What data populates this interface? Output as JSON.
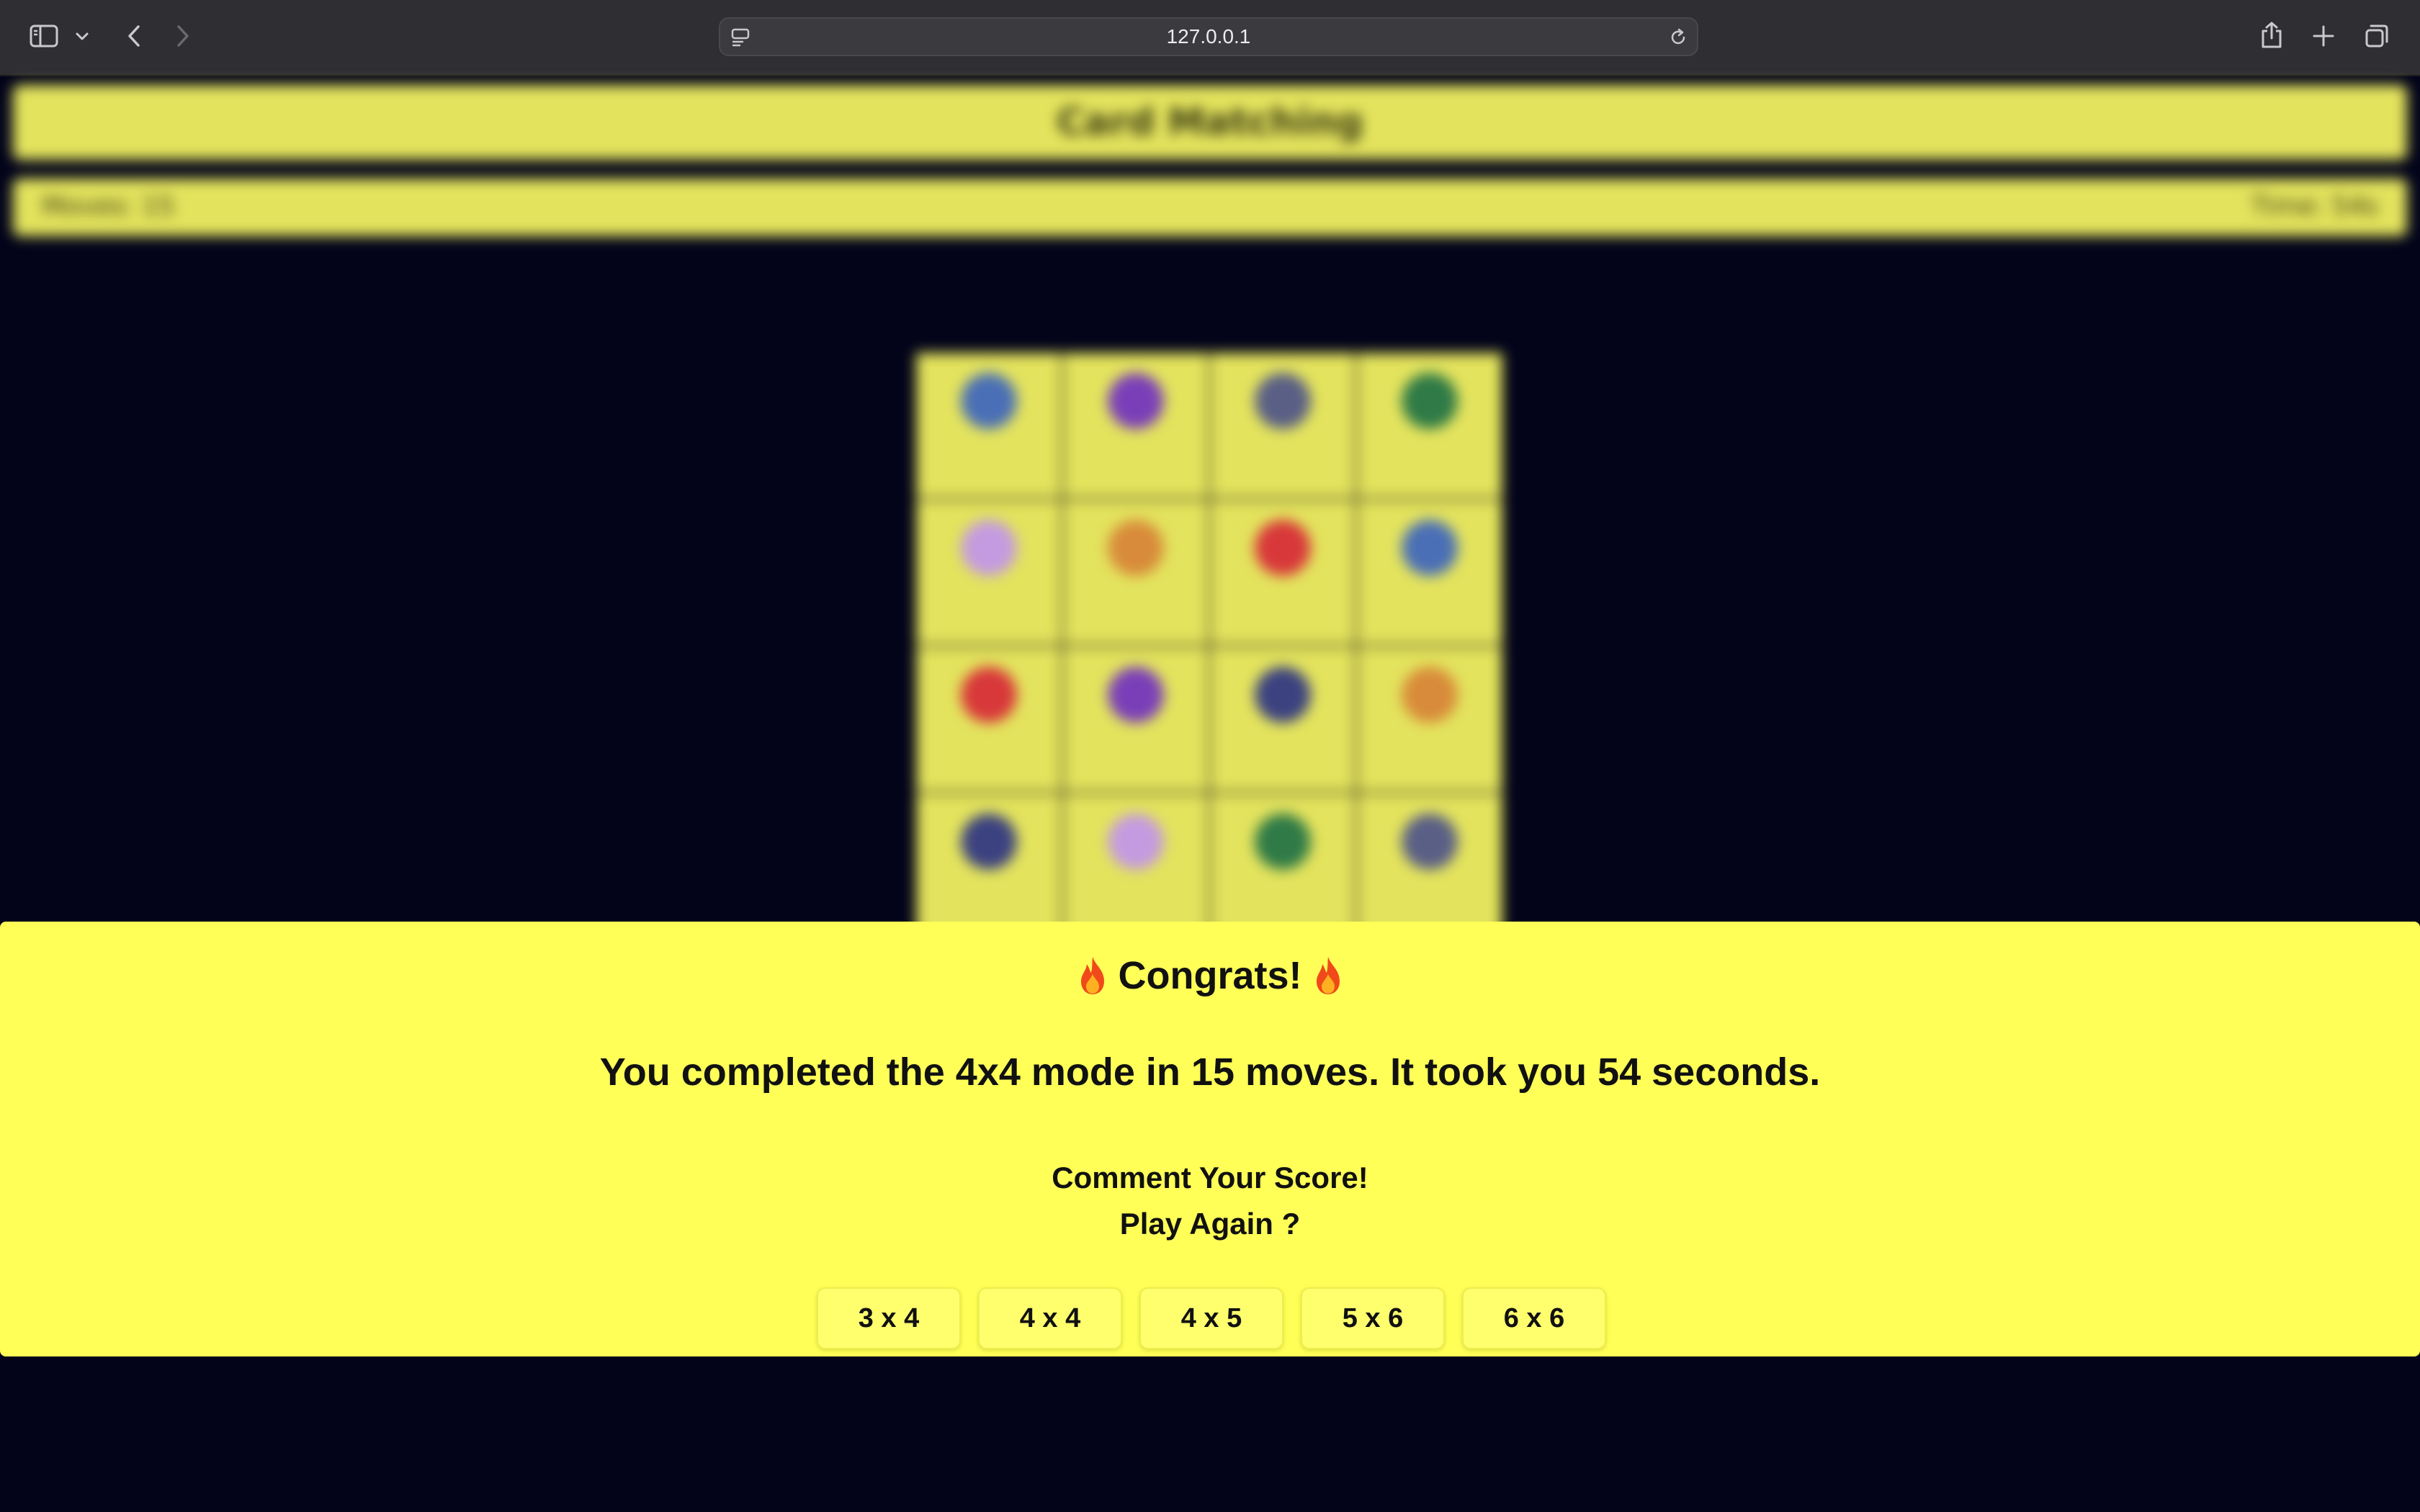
{
  "browser": {
    "url": "127.0.0.1",
    "icons": [
      "sidebar-icon",
      "chevron-down-icon",
      "back-icon",
      "forward-icon",
      "page-menu-icon",
      "reload-icon",
      "share-icon",
      "new-tab-icon",
      "tabs-overview-icon"
    ]
  },
  "game": {
    "title": "Card Matching",
    "moves_label": "Moves: 15",
    "time_label": "Time: 54s",
    "cards": [
      {
        "emoji": "🐳",
        "color": "#4a6fb6"
      },
      {
        "emoji": "😈",
        "color": "#7a3fb8"
      },
      {
        "emoji": "🗿",
        "color": "#5a5f86"
      },
      {
        "emoji": "🦖",
        "color": "#2f7a47"
      },
      {
        "emoji": "🦄",
        "color": "#c49be0"
      },
      {
        "emoji": "🦁",
        "color": "#d88b3a"
      },
      {
        "emoji": "🍎",
        "color": "#d8383a"
      },
      {
        "emoji": "🐳",
        "color": "#4a6fb6"
      },
      {
        "emoji": "🍎",
        "color": "#d8383a"
      },
      {
        "emoji": "😈",
        "color": "#7a3fb8"
      },
      {
        "emoji": "🌑",
        "color": "#3c4280"
      },
      {
        "emoji": "🦁",
        "color": "#d88b3a"
      },
      {
        "emoji": "🌑",
        "color": "#3c4280"
      },
      {
        "emoji": "🦄",
        "color": "#c49be0"
      },
      {
        "emoji": "🦖",
        "color": "#2f7a47"
      },
      {
        "emoji": "🗿",
        "color": "#5a5f86"
      }
    ]
  },
  "modal": {
    "congrats": "Congrats!",
    "flame_icon": "fire-icon",
    "summary": "You completed the 4x4 mode in 15 moves. It took you 54 seconds.",
    "comment": "Comment Your Score!",
    "play_again": "Play Again ?",
    "modes": [
      "3 x 4",
      "4 x 4",
      "4 x 5",
      "5 x 6",
      "6 x 6"
    ]
  },
  "colors": {
    "page_bg": "#03041a",
    "accent_yellow": "#ffff58",
    "card_yellow": "#e3e35d"
  }
}
